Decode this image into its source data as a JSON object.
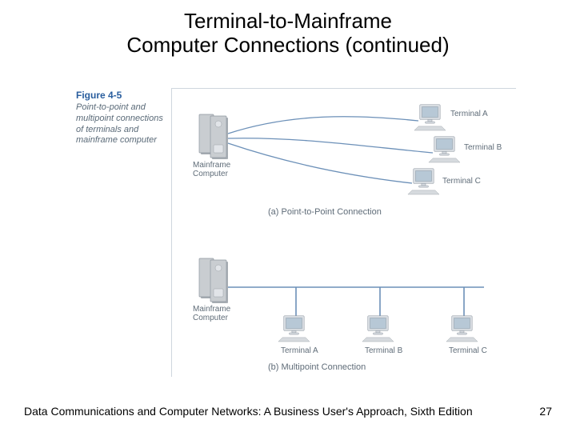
{
  "title_line1": "Terminal-to-Mainframe",
  "title_line2": "Computer Connections (continued)",
  "figure_number": "Figure 4-5",
  "figure_caption": "Point-to-point and multipoint connections of terminals and mainframe computer",
  "labels": {
    "mainframe": "Mainframe\nComputer",
    "termA": "Terminal A",
    "termB": "Terminal B",
    "termC": "Terminal C",
    "subA": "(a) Point-to-Point Connection",
    "subB": "(b) Multipoint Connection"
  },
  "footer_text": "Data Communications and Computer Networks: A Business User's Approach, Sixth Edition",
  "page_number": "27"
}
